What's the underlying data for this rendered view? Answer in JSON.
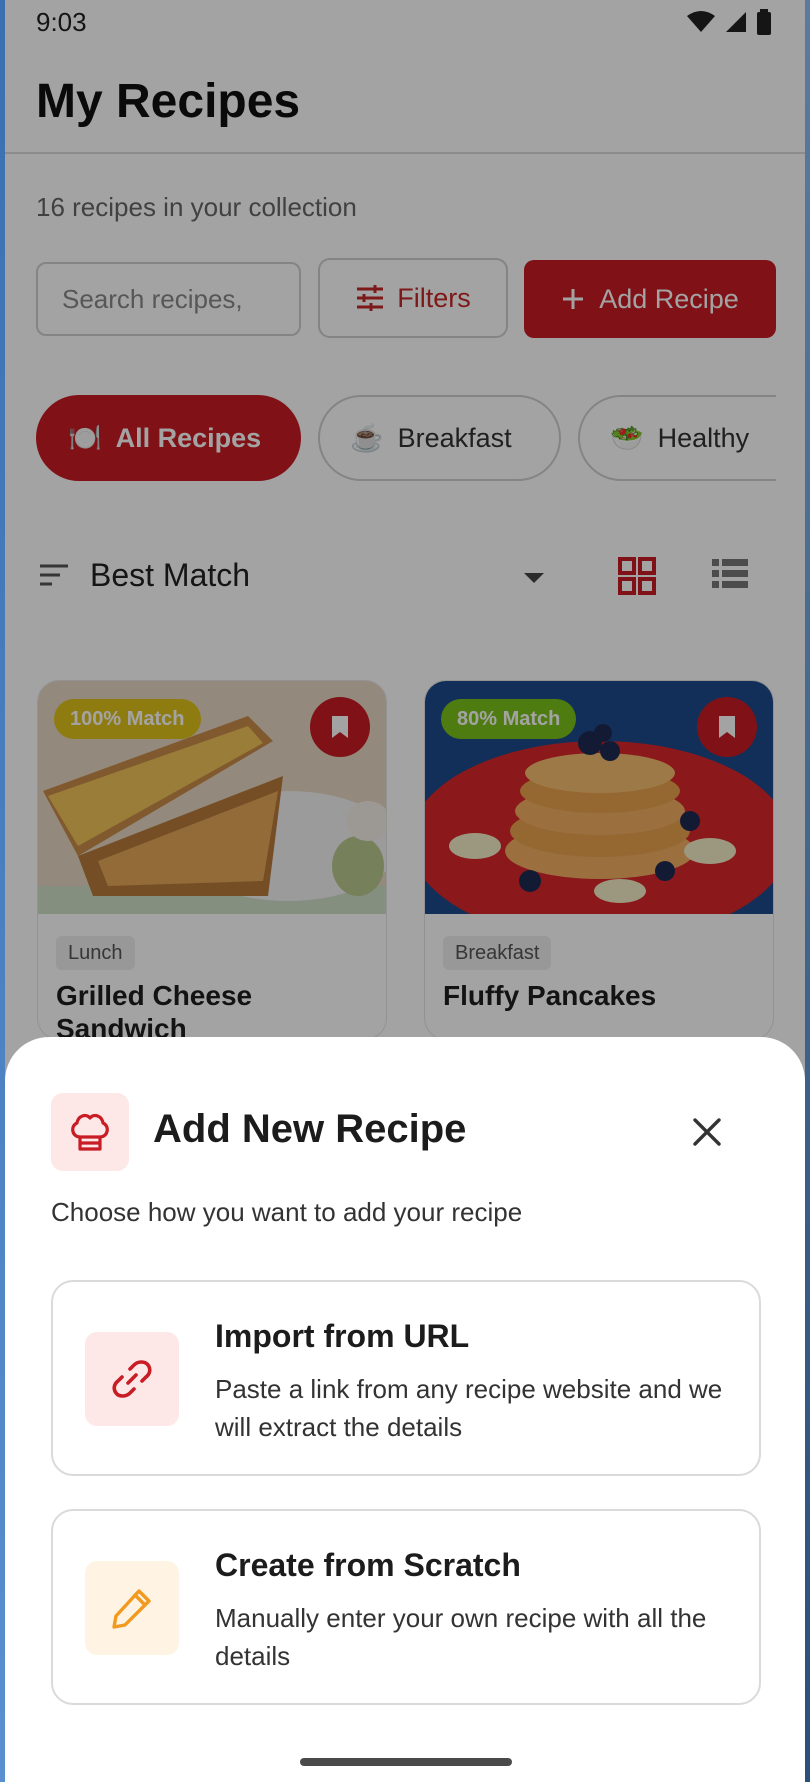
{
  "status": {
    "time": "9:03"
  },
  "header": {
    "title": "My Recipes"
  },
  "collection": {
    "count_text": "16 recipes in your collection"
  },
  "toolbar": {
    "search_placeholder": "Search recipes,",
    "filters_label": "Filters",
    "add_label": "Add Recipe"
  },
  "categories": [
    {
      "emoji": "🍽️",
      "label": "All Recipes",
      "active": true
    },
    {
      "emoji": "☕",
      "label": "Breakfast",
      "active": false
    },
    {
      "emoji": "🥗",
      "label": "Healthy",
      "active": false
    }
  ],
  "sort": {
    "label": "Best Match",
    "view": "grid"
  },
  "recipes": [
    {
      "match": "100% Match",
      "match_color": "#e0c21a",
      "category": "Lunch",
      "title": "Grilled Cheese Sandwich"
    },
    {
      "match": "80% Match",
      "match_color": "#7cc21a",
      "category": "Breakfast",
      "title": "Fluffy Pancakes"
    }
  ],
  "sheet": {
    "title": "Add New Recipe",
    "subtitle": "Choose how you want to add your recipe",
    "options": [
      {
        "icon": "link-icon",
        "title": "Import from URL",
        "description": "Paste a link from any recipe website and we will extract the details",
        "icon_bg": "#fde7e7",
        "icon_color": "#c81d25"
      },
      {
        "icon": "pencil-icon",
        "title": "Create from Scratch",
        "description": "Manually enter your own recipe with all the details",
        "icon_bg": "#fff3e3",
        "icon_color": "#f29a1f"
      }
    ]
  },
  "colors": {
    "accent": "#c81d25"
  }
}
